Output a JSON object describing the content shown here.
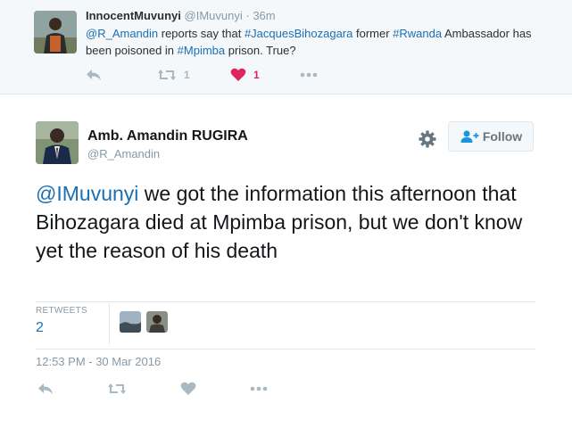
{
  "parent_tweet": {
    "author_name": "InnocentMuvunyi",
    "author_handle": "@IMuvunyi",
    "separator": "·",
    "time": "36m",
    "text_mention": "@R_Amandin",
    "text_part1": " reports say that ",
    "text_hashtag1": "#JacquesBihozagara",
    "text_part2": " former ",
    "text_hashtag2": "#Rwanda",
    "text_part3": " Ambassador has been poisoned in ",
    "text_hashtag3": "#Mpimba",
    "text_part4": " prison. True?",
    "retweet_count": "1",
    "like_count": "1"
  },
  "main_tweet": {
    "author_name": "Amb. Amandin RUGIRA",
    "author_handle": "@R_Amandin",
    "follow_label": "Follow",
    "text_mention": "@IMuvunyi",
    "text_body": " we got the information this afternoon that Bihozagara died at Mpimba prison, but we don't know yet the reason of his death",
    "retweets_label": "RETWEETS",
    "retweets_count": "2",
    "timestamp": "12:53 PM - 30 Mar 2016"
  },
  "colors": {
    "link": "#1b6fb3",
    "heart": "#e0245e",
    "icon_gray": "#aab8c2",
    "parent_bg": "#f5f8fa"
  },
  "icons": [
    "reply-icon",
    "retweet-icon",
    "heart-icon",
    "more-icon",
    "gear-icon",
    "follow-person-icon"
  ]
}
